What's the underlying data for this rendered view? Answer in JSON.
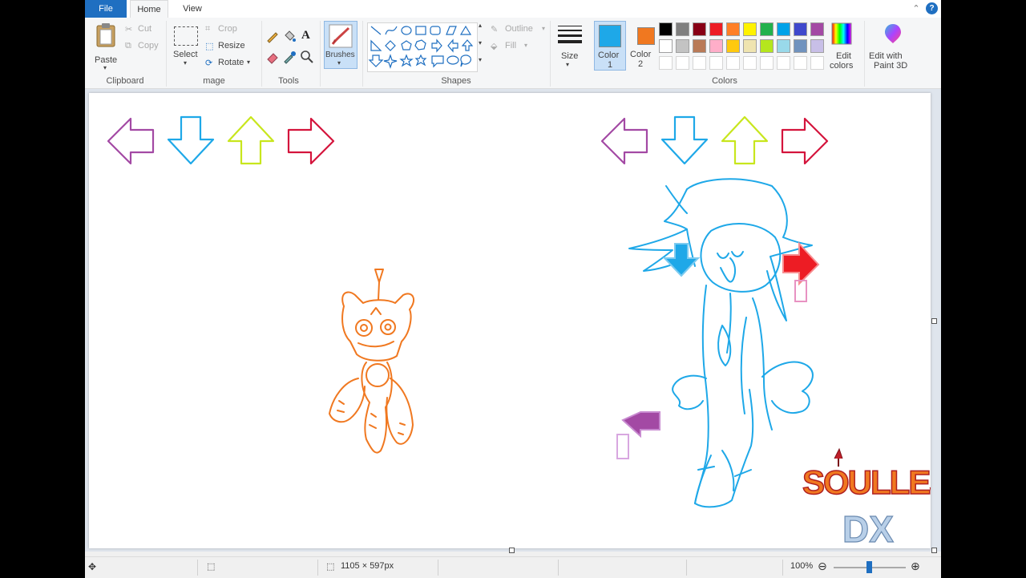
{
  "tabs": {
    "file": "File",
    "home": "Home",
    "view": "View"
  },
  "clipboard": {
    "paste": "Paste",
    "cut": "Cut",
    "copy": "Copy",
    "group": "Clipboard"
  },
  "image": {
    "select": "Select",
    "crop": "Crop",
    "resize": "Resize",
    "rotate": "Rotate",
    "group": "mage"
  },
  "tools": {
    "group": "Tools"
  },
  "brushes": {
    "label": "Brushes"
  },
  "shapes": {
    "outline": "Outline",
    "fill": "Fill",
    "group": "Shapes"
  },
  "size": {
    "label": "Size"
  },
  "color1": {
    "label": "Color",
    "num": "1",
    "value": "#1ea8e8"
  },
  "color2": {
    "label": "Color",
    "num": "2",
    "value": "#f07820"
  },
  "colors": {
    "group": "Colors",
    "edit_line1": "Edit",
    "edit_line2": "colors",
    "paint3d_line1": "Edit with",
    "paint3d_line2": "Paint 3D",
    "row1": [
      "#000000",
      "#7f7f7f",
      "#880015",
      "#ed1c24",
      "#ff7f27",
      "#fff200",
      "#22b14c",
      "#00a2e8",
      "#3f48cc",
      "#a349a4"
    ],
    "row2": [
      "#ffffff",
      "#c3c3c3",
      "#b97a57",
      "#ffaec9",
      "#ffc90e",
      "#efe4b0",
      "#b5e61d",
      "#99d9ea",
      "#7092be",
      "#c8bfe7"
    ]
  },
  "status": {
    "dimensions": "1105 × 597px",
    "zoom": "100%"
  },
  "drawing": {
    "arrow_colors": {
      "left": "#a349a4",
      "down": "#1ea8e8",
      "up": "#c8e61d",
      "right": "#d4143c"
    },
    "character_left_color": "#f07820",
    "character_right_color": "#1ea8e8",
    "logo_text": "SOULLES",
    "logo_sub": "DX"
  }
}
